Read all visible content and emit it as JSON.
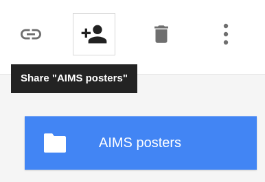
{
  "toolbar": {
    "link_icon": "link-icon",
    "share_icon": "person-add-icon",
    "delete_icon": "trash-icon",
    "more_icon": "more-vertical-icon",
    "icon_color": "#757575"
  },
  "tooltip": {
    "text": "Share \"AIMS posters\"",
    "background": "#232323"
  },
  "folder": {
    "name": "AIMS posters",
    "icon": "folder-icon",
    "card_color": "#4285f4"
  }
}
